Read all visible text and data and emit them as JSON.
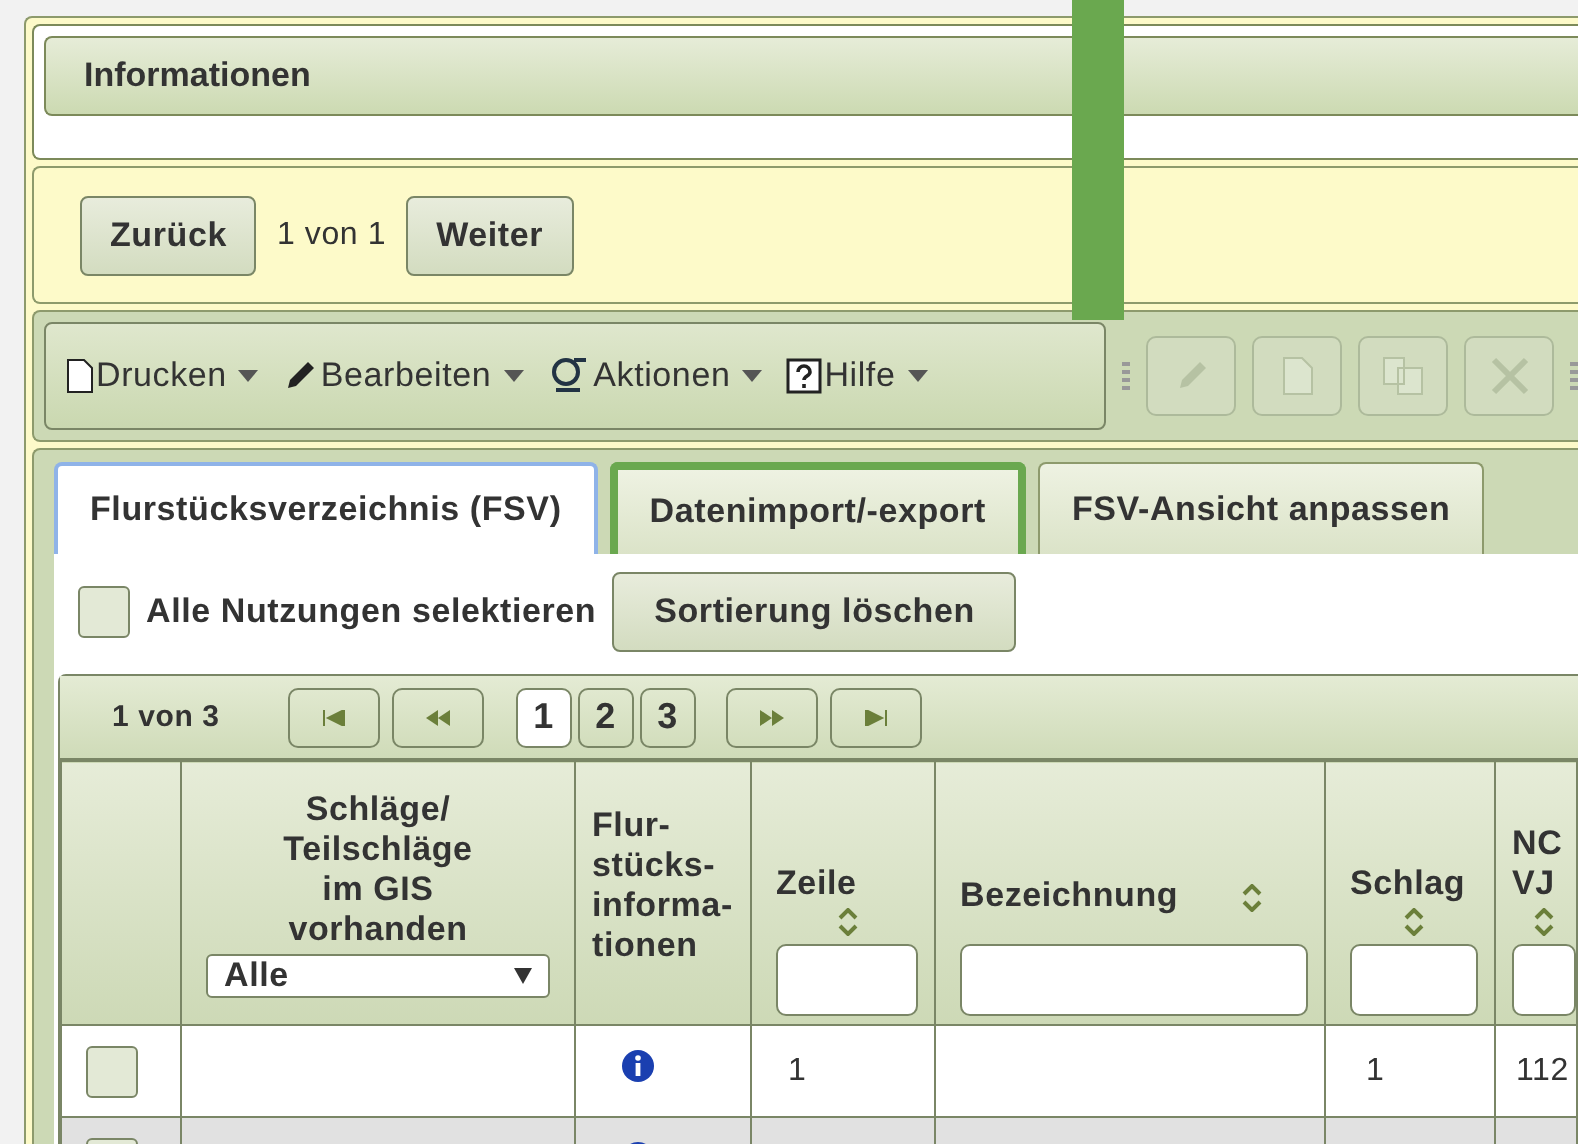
{
  "info_panel": {
    "title": "Informationen"
  },
  "navigation": {
    "back": "Zurück",
    "position": "1 von 1",
    "next": "Weiter"
  },
  "toolbar": {
    "menus": [
      {
        "kind": "print",
        "label": "Drucken"
      },
      {
        "kind": "edit",
        "label": "Bearbeiten"
      },
      {
        "kind": "actions",
        "label": "Aktionen"
      },
      {
        "kind": "help",
        "label": "Hilfe"
      }
    ],
    "tools": [
      {
        "kind": "edit",
        "disabled": true
      },
      {
        "kind": "new",
        "disabled": true
      },
      {
        "kind": "copy",
        "disabled": true
      },
      {
        "kind": "delete",
        "disabled": true
      }
    ]
  },
  "tabs": [
    {
      "label": "Flurstücksverzeichnis (FSV)",
      "selected": true,
      "highlighted": false
    },
    {
      "label": "Datenimport/-export",
      "selected": false,
      "highlighted": true
    },
    {
      "label": "FSV-Ansicht anpassen",
      "selected": false,
      "highlighted": false
    }
  ],
  "select_all": {
    "label": "Alle Nutzungen selektieren",
    "checked": false
  },
  "clear_sort_button": "Sortierung löschen",
  "pager": {
    "position": "1 von 3",
    "pages": [
      {
        "label": "1",
        "selected": true
      },
      {
        "label": "2",
        "selected": false
      },
      {
        "label": "3",
        "selected": false
      }
    ]
  },
  "table": {
    "columns": [
      {
        "kind": "check"
      },
      {
        "kind": "select",
        "label": "Schläge/\nTeilschläge\nim GIS\nvorhanden",
        "value": "Alle"
      },
      {
        "kind": "plain",
        "label": "Flur-\nstücks-\ninforma-\ntionen"
      },
      {
        "kind": "sort",
        "label": "Zeile"
      },
      {
        "kind": "sort",
        "label": "Bezeichnung"
      },
      {
        "kind": "sort",
        "label": "Schlag"
      },
      {
        "kind": "sort",
        "label": "NC\nVJ"
      }
    ],
    "rows": [
      {
        "checked": false,
        "info": true,
        "zeile": "1",
        "bezeichnung": "",
        "schlag": "1",
        "nc_vj": "112"
      },
      {
        "checked": false,
        "info": true
      }
    ]
  }
}
